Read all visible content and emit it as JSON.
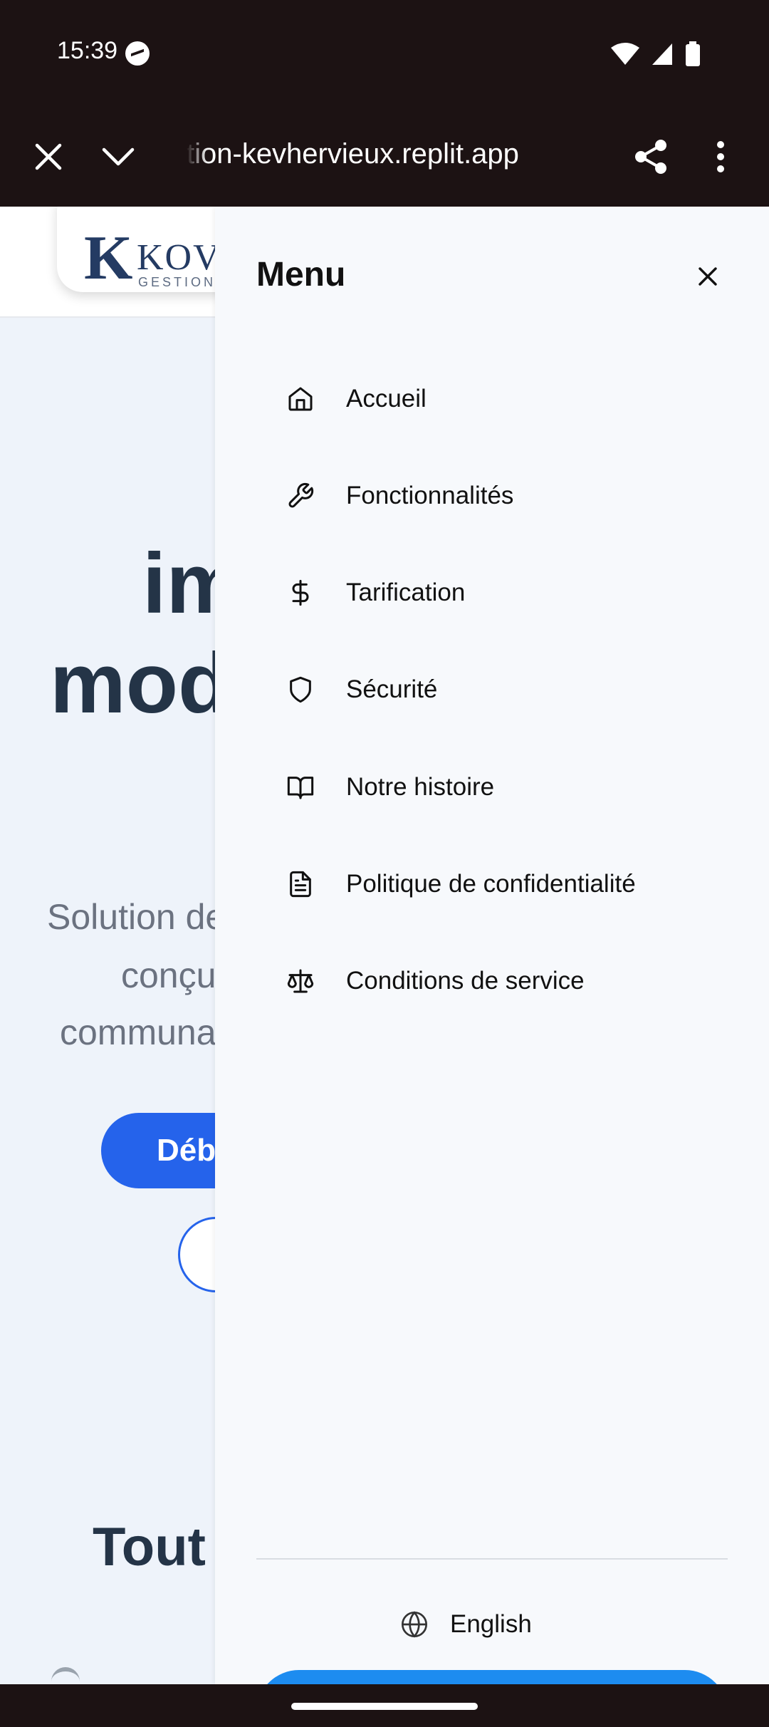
{
  "status_bar": {
    "time": "15:39"
  },
  "browser": {
    "url": "tion-kevhervieux.replit.app"
  },
  "background_page": {
    "logo": {
      "mark": "K",
      "name": "KOVE",
      "sub": "GESTION I"
    },
    "hero_line1": "im",
    "hero_line2": "mod",
    "subtitle_lines": [
      "Solution de",
      "conçu",
      "communa"
    ],
    "cta_primary": "Déb",
    "section_title": "Tout"
  },
  "drawer": {
    "title": "Menu",
    "items": [
      {
        "label": "Accueil",
        "icon": "home-icon"
      },
      {
        "label": "Fonctionnalités",
        "icon": "wrench-icon"
      },
      {
        "label": "Tarification",
        "icon": "dollar-icon"
      },
      {
        "label": "Sécurité",
        "icon": "shield-icon"
      },
      {
        "label": "Notre histoire",
        "icon": "book-icon"
      },
      {
        "label": "Politique de confidentialité",
        "icon": "document-icon"
      },
      {
        "label": "Conditions de service",
        "icon": "scale-icon"
      }
    ],
    "language": "English"
  },
  "colors": {
    "accent": "#2563eb",
    "drawer_button": "#1d8cf0",
    "chrome": "#1c1213"
  }
}
